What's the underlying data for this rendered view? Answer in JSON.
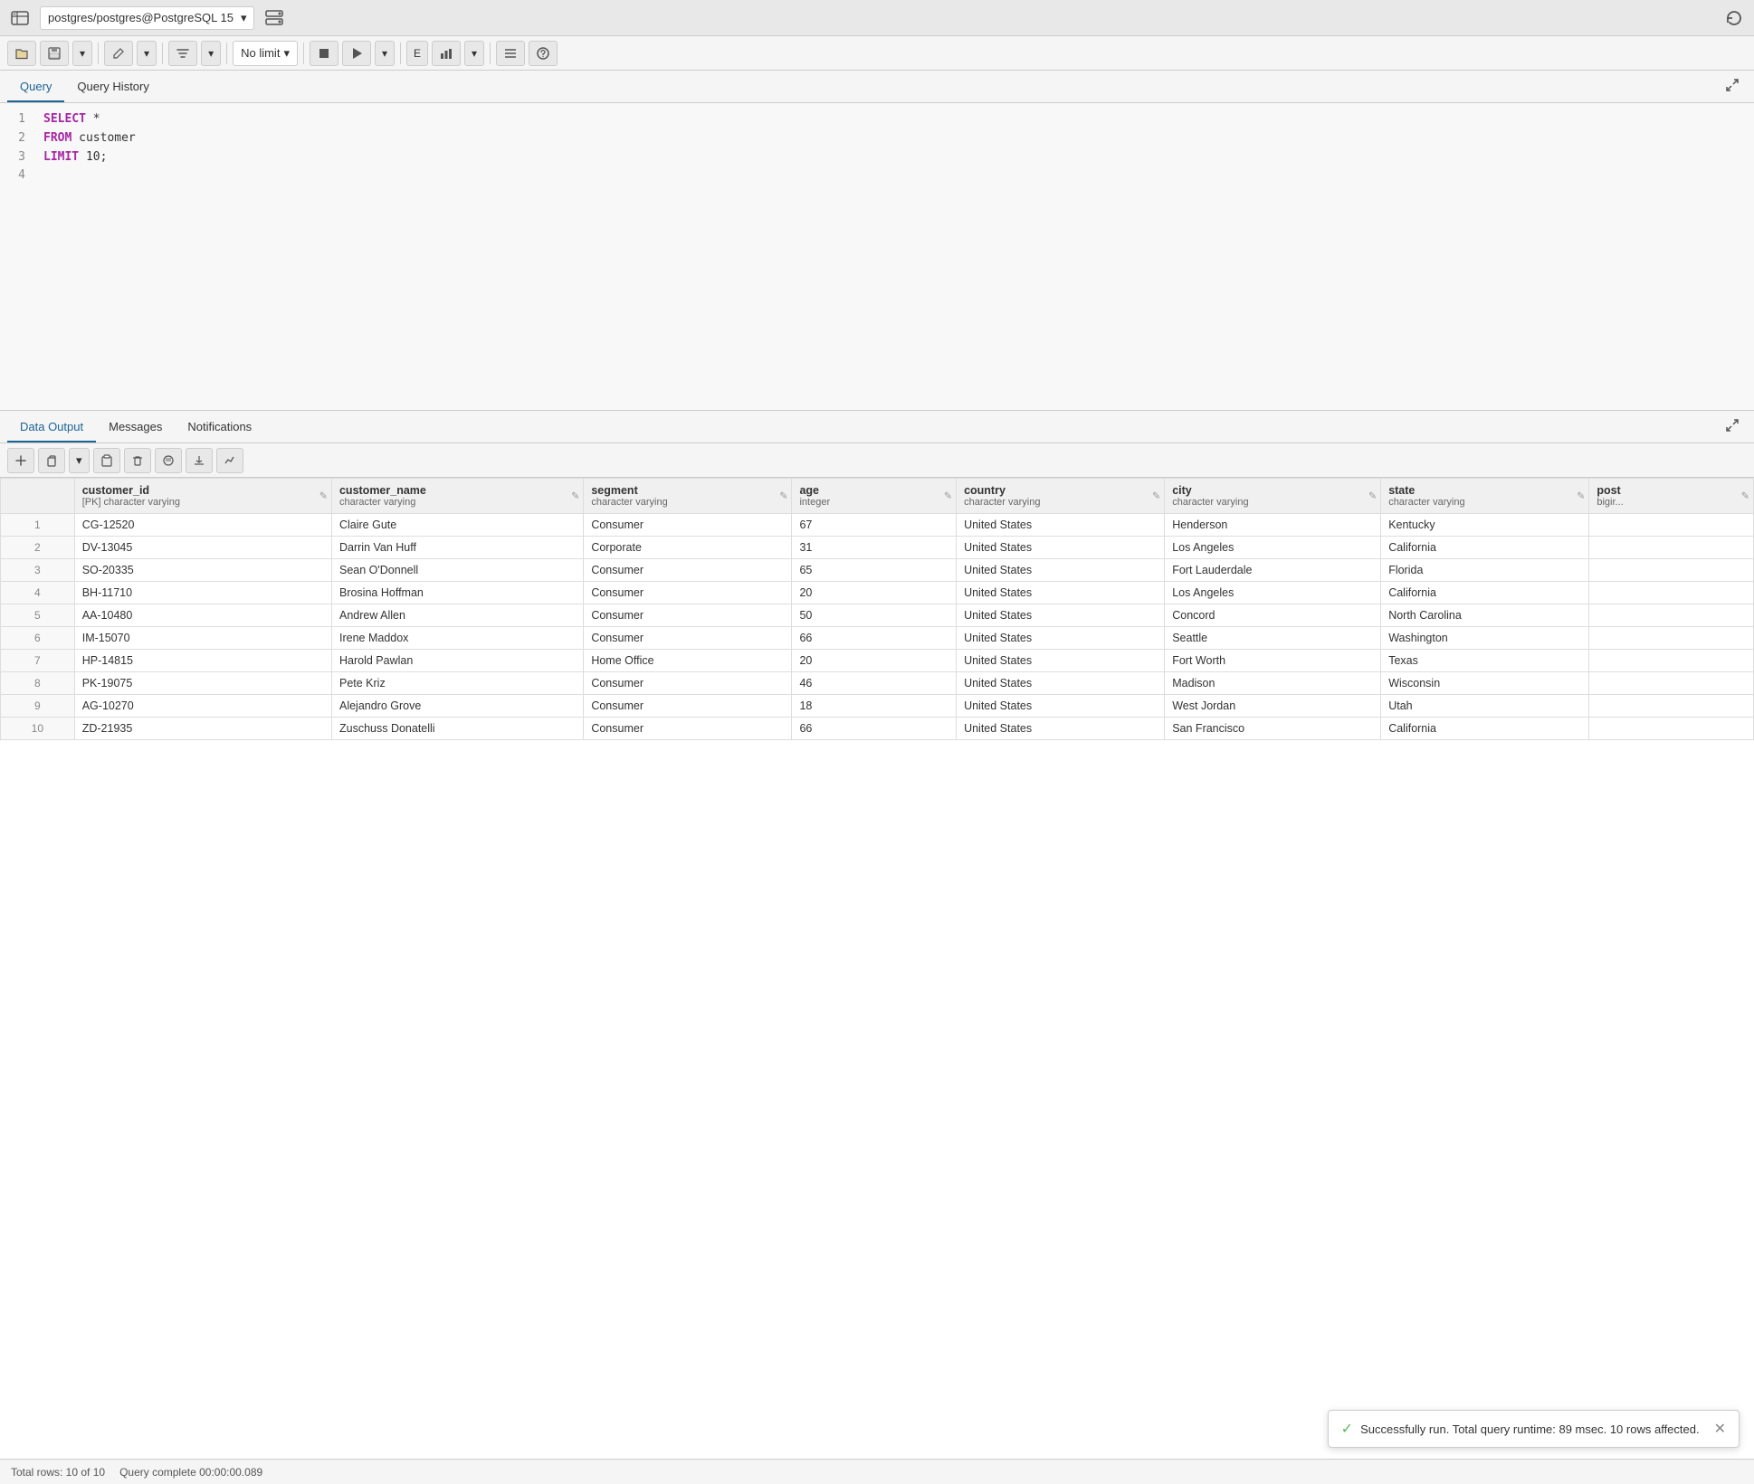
{
  "topbar": {
    "connection": "postgres/postgres@PostgreSQL 15",
    "refresh_icon": "↻"
  },
  "toolbar": {
    "open_label": "📁",
    "save_label": "💾",
    "filter_label": "▼",
    "no_limit": "No limit",
    "stop_label": "■",
    "run_label": "▶",
    "explain_label": "E",
    "chart_label": "📊",
    "macro_label": "≡",
    "help_label": "?"
  },
  "tabs": {
    "query_label": "Query",
    "history_label": "Query History"
  },
  "editor": {
    "lines": [
      {
        "num": 1,
        "content": "SELECT *"
      },
      {
        "num": 2,
        "content": "FROM customer"
      },
      {
        "num": 3,
        "content": "LIMIT 10;"
      },
      {
        "num": 4,
        "content": ""
      }
    ],
    "code_line1_kw": "SELECT",
    "code_line1_rest": " *",
    "code_line2_kw": "FROM",
    "code_line2_rest": " customer",
    "code_line3_kw": "LIMIT",
    "code_line3_rest": " 10;"
  },
  "output_tabs": {
    "data_output_label": "Data Output",
    "messages_label": "Messages",
    "notifications_label": "Notifications"
  },
  "columns": [
    {
      "name": "customer_id",
      "type": "[PK] character varying"
    },
    {
      "name": "customer_name",
      "type": "character varying"
    },
    {
      "name": "segment",
      "type": "character varying"
    },
    {
      "name": "age",
      "type": "integer"
    },
    {
      "name": "country",
      "type": "character varying"
    },
    {
      "name": "city",
      "type": "character varying"
    },
    {
      "name": "state",
      "type": "character varying"
    },
    {
      "name": "post",
      "type": "bigir..."
    }
  ],
  "rows": [
    {
      "num": 1,
      "customer_id": "CG-12520",
      "customer_name": "Claire Gute",
      "segment": "Consumer",
      "age": "67",
      "country": "United States",
      "city": "Henderson",
      "state": "Kentucky",
      "post": ""
    },
    {
      "num": 2,
      "customer_id": "DV-13045",
      "customer_name": "Darrin Van Huff",
      "segment": "Corporate",
      "age": "31",
      "country": "United States",
      "city": "Los Angeles",
      "state": "California",
      "post": ""
    },
    {
      "num": 3,
      "customer_id": "SO-20335",
      "customer_name": "Sean O'Donnell",
      "segment": "Consumer",
      "age": "65",
      "country": "United States",
      "city": "Fort Lauderdale",
      "state": "Florida",
      "post": ""
    },
    {
      "num": 4,
      "customer_id": "BH-11710",
      "customer_name": "Brosina Hoffman",
      "segment": "Consumer",
      "age": "20",
      "country": "United States",
      "city": "Los Angeles",
      "state": "California",
      "post": ""
    },
    {
      "num": 5,
      "customer_id": "AA-10480",
      "customer_name": "Andrew Allen",
      "segment": "Consumer",
      "age": "50",
      "country": "United States",
      "city": "Concord",
      "state": "North Carolina",
      "post": ""
    },
    {
      "num": 6,
      "customer_id": "IM-15070",
      "customer_name": "Irene Maddox",
      "segment": "Consumer",
      "age": "66",
      "country": "United States",
      "city": "Seattle",
      "state": "Washington",
      "post": ""
    },
    {
      "num": 7,
      "customer_id": "HP-14815",
      "customer_name": "Harold Pawlan",
      "segment": "Home Office",
      "age": "20",
      "country": "United States",
      "city": "Fort Worth",
      "state": "Texas",
      "post": ""
    },
    {
      "num": 8,
      "customer_id": "PK-19075",
      "customer_name": "Pete Kriz",
      "segment": "Consumer",
      "age": "46",
      "country": "United States",
      "city": "Madison",
      "state": "Wisconsin",
      "post": ""
    },
    {
      "num": 9,
      "customer_id": "AG-10270",
      "customer_name": "Alejandro Grove",
      "segment": "Consumer",
      "age": "18",
      "country": "United States",
      "city": "West Jordan",
      "state": "Utah",
      "post": ""
    },
    {
      "num": 10,
      "customer_id": "ZD-21935",
      "customer_name": "Zuschuss Donatelli",
      "segment": "Consumer",
      "age": "66",
      "country": "United States",
      "city": "San Francisco",
      "state": "California",
      "post": ""
    }
  ],
  "statusbar": {
    "total_rows": "Total rows: 10 of 10",
    "query_complete": "Query complete 00:00:00.089"
  },
  "notification": {
    "message": "Successfully run. Total query runtime: 89 msec. 10 rows affected.",
    "close": "✕"
  }
}
